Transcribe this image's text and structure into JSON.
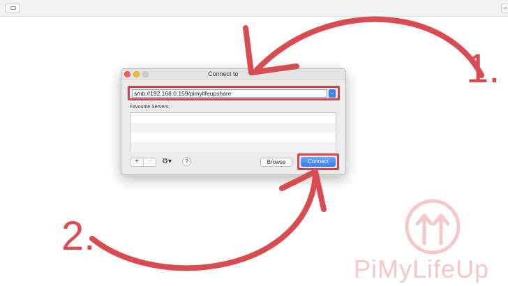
{
  "dialog": {
    "title": "Connect to",
    "server_address": "smb://192.168.0.159/pimylifeupshare",
    "favourites_label": "Favourite Servers:",
    "favourites_rows": [
      "",
      "",
      "",
      ""
    ],
    "add_label": "+",
    "remove_label": "−",
    "gear_label": "⚙︎▾",
    "help_label": "?",
    "browse_label": "Browse",
    "connect_label": "Connect"
  },
  "annotations": {
    "step_1": "1.",
    "step_2": "2.",
    "accent_color": "#d84b4e"
  },
  "watermark": {
    "text": "PiMyLifeUp",
    "color": "#f4c7c8"
  }
}
